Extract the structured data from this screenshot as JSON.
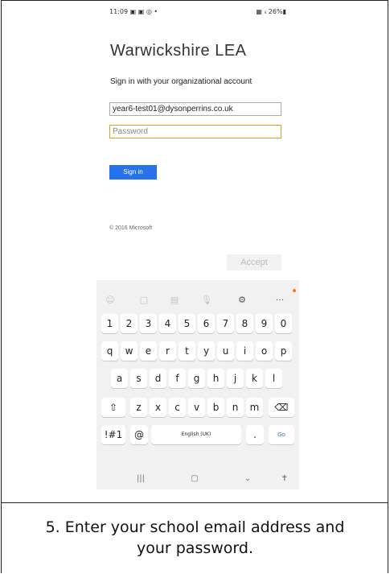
{
  "status_bar": {
    "time": "11:09",
    "left_icons": "▣ ▣ ◎ •",
    "right_icons": "▦ ᵢₗ 26%▮"
  },
  "login": {
    "brand": "Warwickshire LEA",
    "subtitle": "Sign in with your organizational account",
    "email_value": "year6-test01@dysonperrins.co.uk",
    "password_placeholder": "Password",
    "signin_label": "Sign in",
    "copyright": "© 2016 Microsoft",
    "accept_label": "Accept"
  },
  "keyboard": {
    "toolbar": [
      {
        "name": "emoji-icon",
        "glyph": "☺"
      },
      {
        "name": "sticker-icon",
        "glyph": "▢"
      },
      {
        "name": "clipboard-icon",
        "glyph": "▤"
      },
      {
        "name": "microphone-icon",
        "glyph": "🎙"
      },
      {
        "name": "settings-icon",
        "glyph": "⚙"
      },
      {
        "name": "more-icon",
        "glyph": "···"
      }
    ],
    "number_row": [
      "1",
      "2",
      "3",
      "4",
      "5",
      "6",
      "7",
      "8",
      "9",
      "0"
    ],
    "row1": [
      "q",
      "w",
      "e",
      "r",
      "t",
      "y",
      "u",
      "i",
      "o",
      "p"
    ],
    "row2": [
      "a",
      "s",
      "d",
      "f",
      "g",
      "h",
      "j",
      "k",
      "l"
    ],
    "row3": [
      "z",
      "x",
      "c",
      "v",
      "b",
      "n",
      "m"
    ],
    "shift_glyph": "⇧",
    "backspace_glyph": "⌫",
    "symbols_label": "!#1",
    "at_label": "@",
    "space_label": "English (UK)",
    "period_label": ".",
    "go_label": "Go",
    "nav": [
      {
        "name": "recent-apps-icon",
        "glyph": "|||"
      },
      {
        "name": "home-icon",
        "glyph": "▢"
      },
      {
        "name": "back-icon",
        "glyph": "⌄"
      },
      {
        "name": "accessibility-icon",
        "glyph": "✝"
      }
    ],
    "accent": "#2b6bd8"
  },
  "caption": {
    "line1": "5. Enter your school email address and",
    "line2": "your password."
  }
}
